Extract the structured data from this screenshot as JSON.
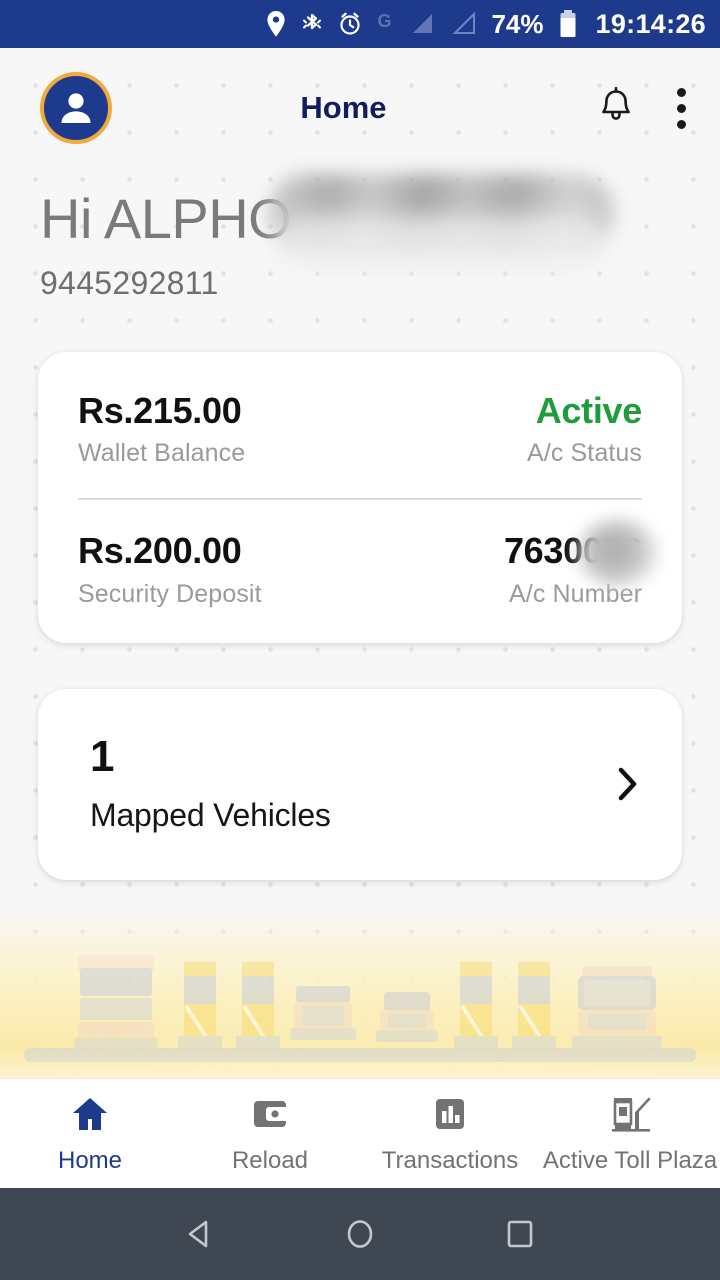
{
  "status_bar": {
    "icons": [
      "location-pin-icon",
      "bluetooth-icon",
      "alarm-clock-icon",
      "gprs-icon",
      "signal-1-icon",
      "signal-2-icon"
    ],
    "network_label": "G",
    "battery_percent": "74%",
    "time": "19:14:26",
    "background_color": "#1e3a8c",
    "text_color": "#ffffff"
  },
  "header": {
    "title": "Home",
    "avatar_icon": "person-avatar-icon",
    "notification_icon": "bell-icon",
    "overflow_icon": "kebab-menu-icon",
    "title_color": "#131c5e",
    "avatar_ring_color": "#f2a93b",
    "avatar_fill_color": "#1e3a8c"
  },
  "greeting": {
    "text": "Hi ALPHO",
    "redacted": true,
    "phone_number": "9445292811"
  },
  "account_card": {
    "wallet_balance_value": "Rs.215.00",
    "wallet_balance_label": "Wallet Balance",
    "account_status_value": "Active",
    "account_status_label": "A/c Status",
    "account_status_color": "#1f9d3d",
    "security_deposit_value": "Rs.200.00",
    "security_deposit_label": "Security Deposit",
    "account_number_value": "7630076",
    "account_number_label": "A/c Number",
    "account_number_redacted": true
  },
  "vehicles_card": {
    "count": "1",
    "label": "Mapped Vehicles",
    "chevron_icon": "chevron-right-icon"
  },
  "illustration": {
    "name": "toll-plaza-illustration",
    "description": "Faded toll plaza scene with trucks, cars, bus and toll booths"
  },
  "bottom_nav": {
    "active_index": 0,
    "active_color": "#1e3a8c",
    "inactive_color": "#737373",
    "items": [
      {
        "label": "Home",
        "icon": "home-icon"
      },
      {
        "label": "Reload",
        "icon": "wallet-icon"
      },
      {
        "label": "Transactions",
        "icon": "bar-chart-icon"
      },
      {
        "label": "Active Toll Plaza",
        "icon": "toll-booth-icon"
      }
    ]
  },
  "android_nav": {
    "background_color": "#3f4752",
    "buttons": [
      {
        "name": "back-button",
        "icon": "triangle-back-icon"
      },
      {
        "name": "home-button",
        "icon": "circle-home-icon"
      },
      {
        "name": "recents-button",
        "icon": "square-recents-icon"
      }
    ]
  }
}
